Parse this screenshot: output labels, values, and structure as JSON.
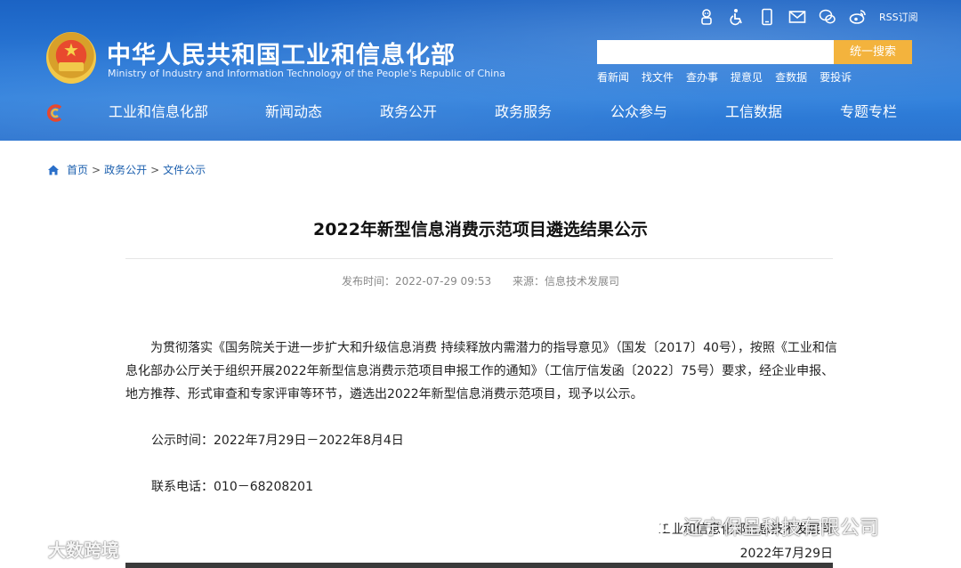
{
  "header": {
    "title": "中华人民共和国工业和信息化部",
    "subtitle": "Ministry of Industry and Information Technology of the People's Republic of China",
    "top_icons": [
      "robot-icon",
      "accessibility-icon",
      "mobile-icon",
      "mail-icon",
      "wechat-icon",
      "weibo-icon"
    ],
    "rss_label": "RSS订阅",
    "search_placeholder": "",
    "search_button": "统一搜索",
    "quick_links": [
      "看新闻",
      "找文件",
      "查办事",
      "提意见",
      "查数据",
      "要投诉"
    ]
  },
  "nav": {
    "items": [
      "工业和信息化部",
      "新闻动态",
      "政务公开",
      "政务服务",
      "公众参与",
      "工信数据",
      "专题专栏"
    ]
  },
  "breadcrumb": {
    "items": [
      "首页",
      "政务公开",
      "文件公示"
    ],
    "separator": ">"
  },
  "article": {
    "title": "2022年新型信息消费示范项目遴选结果公示",
    "publish_time_label": "发布时间：2022-07-29 09:53",
    "source_label": "来源：信息技术发展司",
    "paragraph": "为贯彻落实《国务院关于进一步扩大和升级信息消费 持续释放内需潜力的指导意见》（国发〔2017〕40号），按照《工业和信息化部办公厅关于组织开展2022年新型信息消费示范项目申报工作的通知》（工信厅信发函〔2022〕75号）要求，经企业申报、地方推荐、形式审查和专家评审等环节，遴选出2022年新型信息消费示范项目，现予以公示。",
    "notice_period": "公示时间：2022年7月29日－2022年8月4日",
    "contact_phone": "联系电话：010－68208201",
    "signature_org": "工业和信息化部信息技术发展司",
    "signature_date": "2022年7月29日"
  },
  "watermarks": {
    "left": "大数跨境",
    "right": "辽宁保呈科技有限公司"
  },
  "colors": {
    "header_blue": "#2a78d6",
    "search_button": "#f3b33d",
    "breadcrumb_link": "#1b5fae"
  }
}
